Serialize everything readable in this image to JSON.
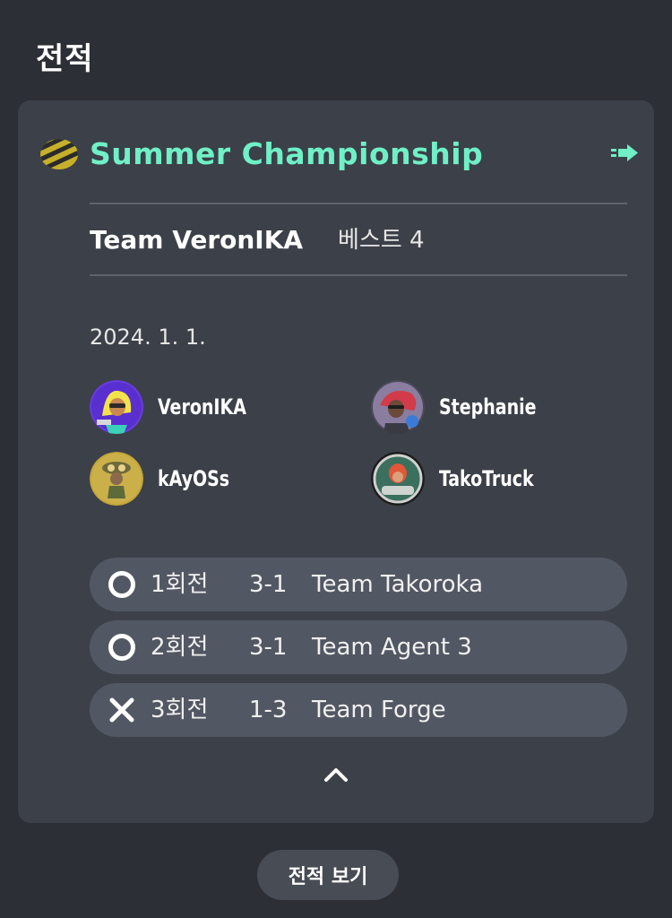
{
  "page": {
    "title": "전적"
  },
  "tournament": {
    "name": "Summer Championship",
    "team_name": "Team VeronIKA",
    "result": "베스트 4",
    "date": "2024. 1. 1."
  },
  "players": [
    {
      "name": "VeronIKA",
      "avatar": "inkling-avatar-purple"
    },
    {
      "name": "Stephanie",
      "avatar": "octoling-avatar-red"
    },
    {
      "name": "kAyOSs",
      "avatar": "gold-avatar"
    },
    {
      "name": "TakoTruck",
      "avatar": "octoling-avatar-dark"
    }
  ],
  "rounds": [
    {
      "icon": "circle-win-icon",
      "label": "1회전",
      "score": "3-1",
      "opponent": "Team Takoroka"
    },
    {
      "icon": "circle-win-icon",
      "label": "2회전",
      "score": "3-1",
      "opponent": "Team Agent 3"
    },
    {
      "icon": "x-loss-icon",
      "label": "3회전",
      "score": "1-3",
      "opponent": "Team Forge"
    }
  ],
  "footer": {
    "history_button": "전적 보기"
  },
  "colors": {
    "accent": "#6ff0c6",
    "background": "#2c2f36",
    "card": "#3c4049",
    "round_bg": "#525863"
  }
}
